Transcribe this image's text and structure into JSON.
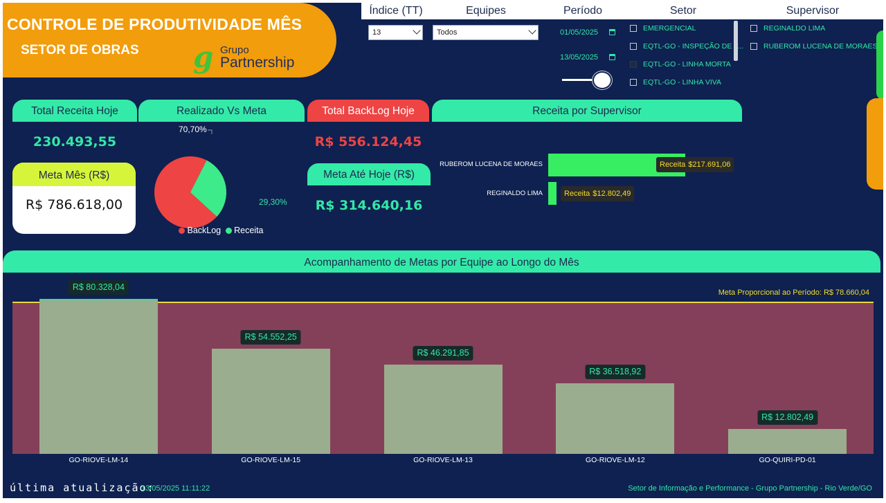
{
  "header": {
    "title": "CONTROLE DE PRODUTIVIDADE MÊS",
    "subtitle": "SETOR DE OBRAS",
    "logo_line1": "Grupo",
    "logo_line2": "Partnership"
  },
  "filters": {
    "indice": {
      "label": "Índice (TT)",
      "value": "13"
    },
    "equipes": {
      "label": "Equipes",
      "value": "Todos"
    },
    "periodo": {
      "label": "Período",
      "start": "01/05/2025",
      "end": "13/05/2025",
      "slider_position": 1.0
    },
    "setor": {
      "label": "Setor",
      "options": [
        {
          "label": "EMERGENCIAL",
          "checked": false
        },
        {
          "label": "EQTL-GO - INSPEÇÃO DE F...",
          "checked": false
        },
        {
          "label": "EQTL-GO - LINHA MORTA",
          "checked": true
        },
        {
          "label": "EQTL-GO - LINHA VIVA",
          "checked": false
        }
      ]
    },
    "supervisor": {
      "label": "Supervisor",
      "options": [
        {
          "label": "REGINALDO LIMA",
          "checked": false
        },
        {
          "label": "RUBEROM LUCENA DE MORAES",
          "checked": false
        }
      ]
    }
  },
  "kpis": {
    "receita_hoje": {
      "label": "Total Receita Hoje",
      "value": "230.493,55"
    },
    "meta_mes": {
      "label": "Meta Mês (R$)",
      "value": "R$ 786.618,00"
    },
    "backlog_hoje": {
      "label": "Total BackLog Hoje",
      "value": "R$ 556.124,45"
    },
    "meta_ate_hoje": {
      "label": "Meta Até Hoje (R$)",
      "value": "R$ 314.640,16"
    }
  },
  "realizado_vs_meta": {
    "label": "Realizado Vs Meta",
    "backlog_pct_label": "70,70%",
    "receita_pct_label": "29,30%",
    "legend_backlog": "BackLog",
    "legend_receita": "Receita"
  },
  "receita_supervisor": {
    "label": "Receita por Supervisor",
    "tooltip_key": "Receita",
    "rows": [
      {
        "name": "RUBEROM LUCENA DE MORAES",
        "value_label": "$217.691,06"
      },
      {
        "name": "REGINALDO LIMA",
        "value_label": "$12.802,49"
      }
    ]
  },
  "chart_data": [
    {
      "type": "pie",
      "title": "Realizado Vs Meta",
      "labels": [
        "BackLog",
        "Receita"
      ],
      "values": [
        70.7,
        29.3
      ],
      "colors": [
        "#ee4444",
        "#3deb8a"
      ],
      "legend_position": "bottom"
    },
    {
      "type": "bar",
      "title": "Receita por Supervisor",
      "orientation": "horizontal",
      "categories": [
        "RUBEROM LUCENA DE MORAES",
        "REGINALDO LIMA"
      ],
      "values": [
        217691.06,
        12802.49
      ],
      "xlim": [
        0,
        217691.06
      ]
    },
    {
      "type": "bar",
      "title": "Acompanhamento de Metas por  Equipe ao Longo do Mês",
      "categories": [
        "GO-RIOVE-LM-14",
        "GO-RIOVE-LM-15",
        "GO-RIOVE-LM-13",
        "GO-RIOVE-LM-12",
        "GO-QUIRI-PD-01"
      ],
      "values": [
        80328.04,
        54552.25,
        46291.85,
        36518.92,
        12802.49
      ],
      "value_labels": [
        "R$ 80.328,04",
        "R$ 54.552,25",
        "R$ 46.291,85",
        "R$ 36.518,92",
        "R$ 12.802,49"
      ],
      "reference_line": {
        "label": "Meta Proporcional ao Período: R$ 78.660,04",
        "value": 78660.04
      },
      "ylim": [
        0,
        80328.04
      ]
    }
  ],
  "footer": {
    "update_label": "última atualização:",
    "update_timestamp": "13/05/2025 11:11:22",
    "credit": "Setor de Informação e Performance - Grupo Partnership - Rio Verde/GO"
  },
  "colors": {
    "background": "#0e2150",
    "accent_green": "#34eaa8",
    "banner_orange": "#f29d0c",
    "backlog_red": "#ee4444",
    "bar_sage": "#9bad8f",
    "chart_bg": "#854059",
    "meta_line": "#ecd63f"
  }
}
